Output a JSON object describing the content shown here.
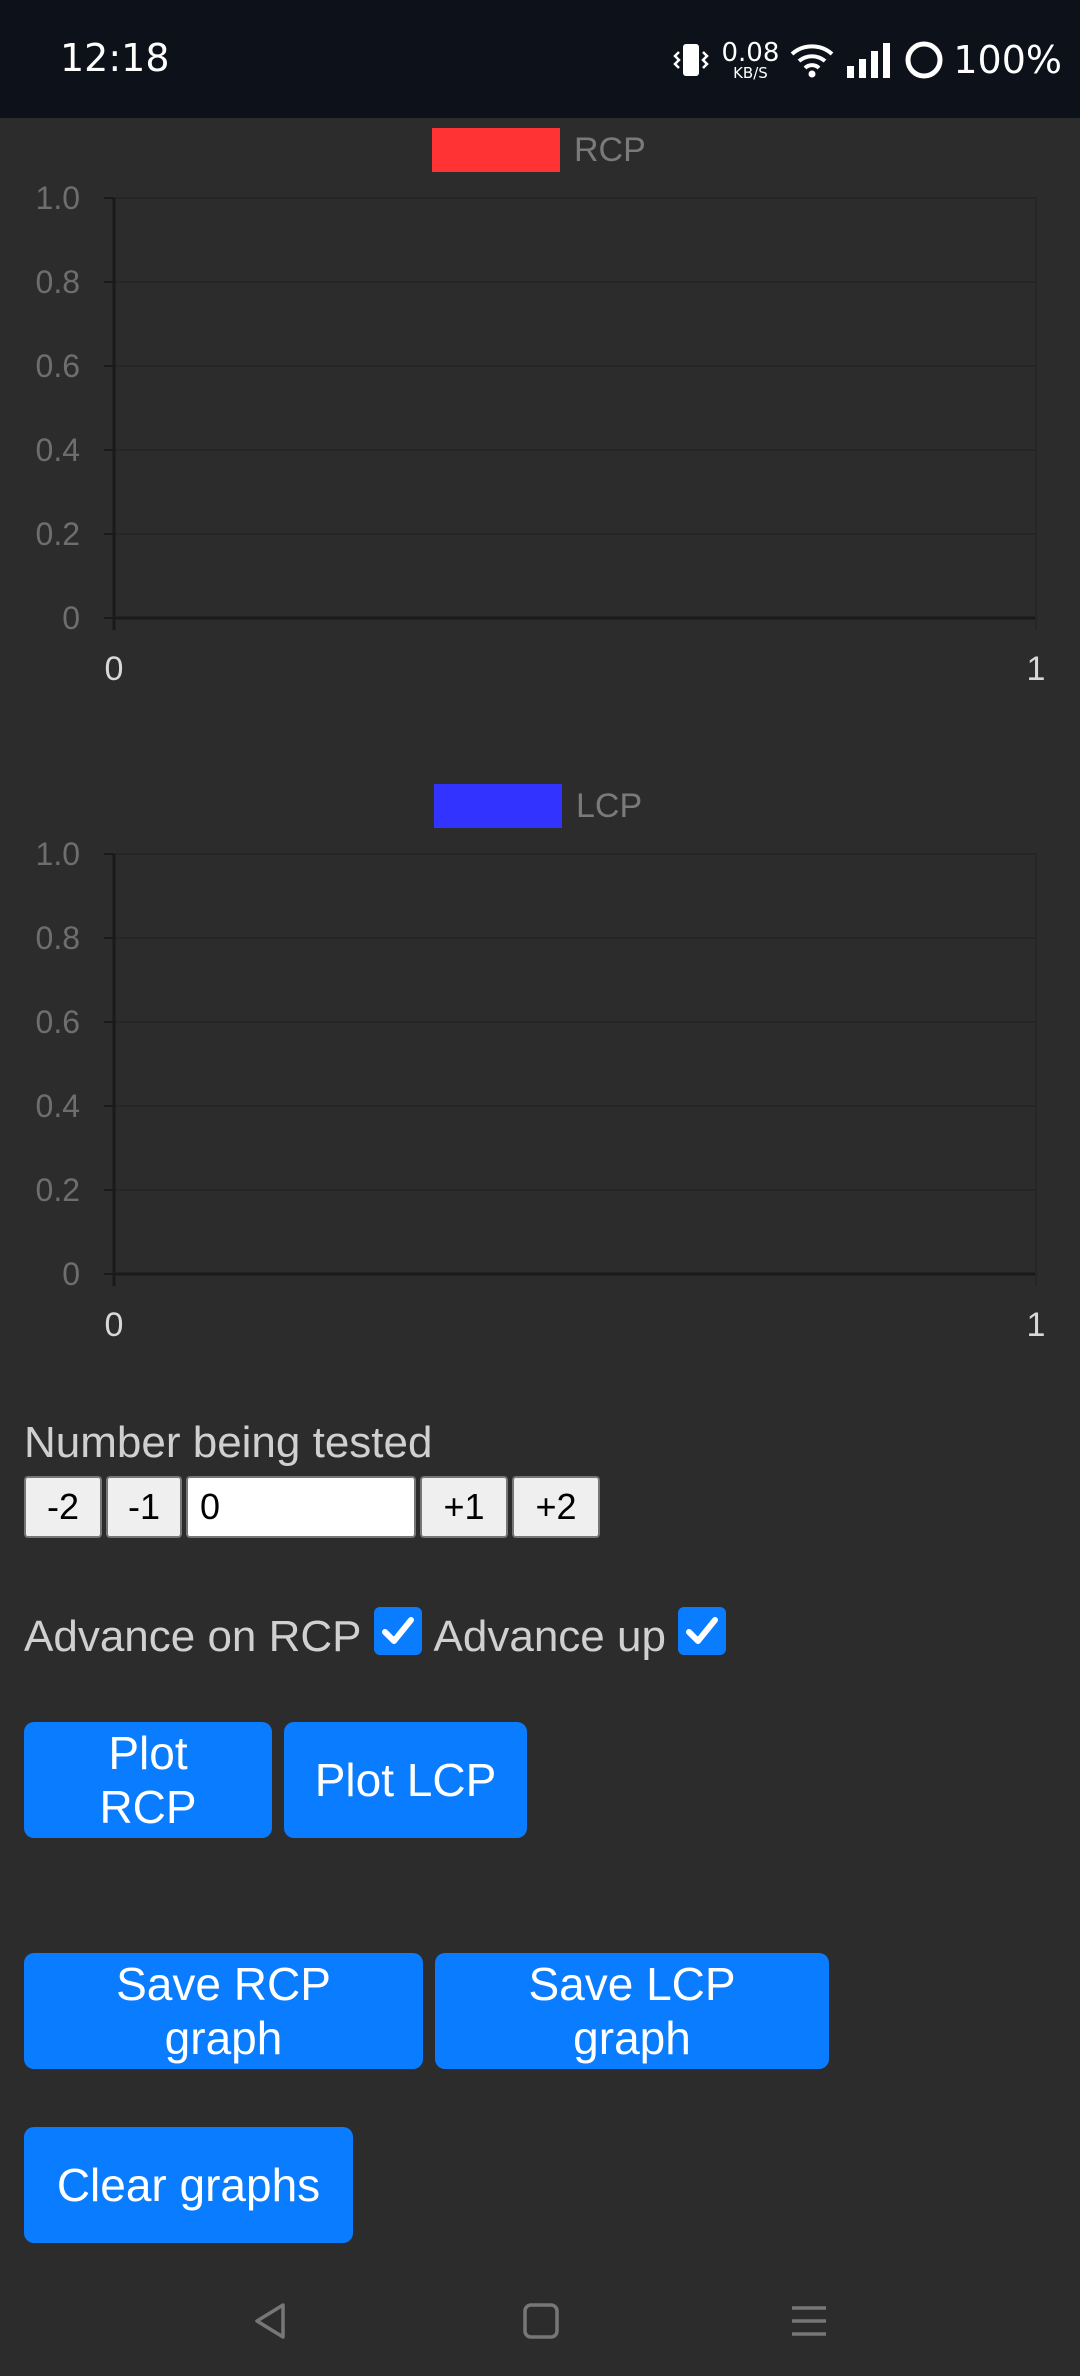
{
  "status_bar": {
    "time": "12:18",
    "net_speed_value": "0.08",
    "net_speed_unit": "KB/S",
    "battery": "100%",
    "icons": [
      "vibrate-icon",
      "wifi-icon",
      "signal-icon",
      "battery-ring-icon"
    ]
  },
  "colors": {
    "rcp": "#ff3333",
    "lcp": "#3333ff",
    "accent": "#0a7cff",
    "background": "#2c2c2c"
  },
  "chart_data": [
    {
      "type": "line",
      "series": [
        {
          "name": "RCP",
          "values": []
        }
      ],
      "xlim": [
        0,
        1
      ],
      "ylim": [
        0,
        1.0
      ],
      "x_ticks": [
        "0",
        "1"
      ],
      "y_ticks": [
        "1.0",
        "0.8",
        "0.6",
        "0.4",
        "0.2",
        "0"
      ],
      "legend": "top-center",
      "grid": true
    },
    {
      "type": "line",
      "series": [
        {
          "name": "LCP",
          "values": []
        }
      ],
      "xlim": [
        0,
        1
      ],
      "ylim": [
        0,
        1.0
      ],
      "x_ticks": [
        "0",
        "1"
      ],
      "y_ticks": [
        "1.0",
        "0.8",
        "0.6",
        "0.4",
        "0.2",
        "0"
      ],
      "legend": "top-center",
      "grid": true
    }
  ],
  "controls": {
    "number_label": "Number being tested",
    "stepper": {
      "minus2": "-2",
      "minus1": "-1",
      "value": "0",
      "plus1": "+1",
      "plus2": "+2"
    },
    "advance_on_rcp_label": "Advance on RCP",
    "advance_on_rcp_checked": true,
    "advance_up_label": "Advance up",
    "advance_up_checked": true
  },
  "buttons": {
    "plot_rcp": "Plot RCP",
    "plot_lcp": "Plot LCP",
    "save_rcp": "Save RCP graph",
    "save_lcp": "Save LCP graph",
    "clear": "Clear graphs"
  },
  "nav": [
    "back-icon",
    "home-icon",
    "menu-icon"
  ]
}
